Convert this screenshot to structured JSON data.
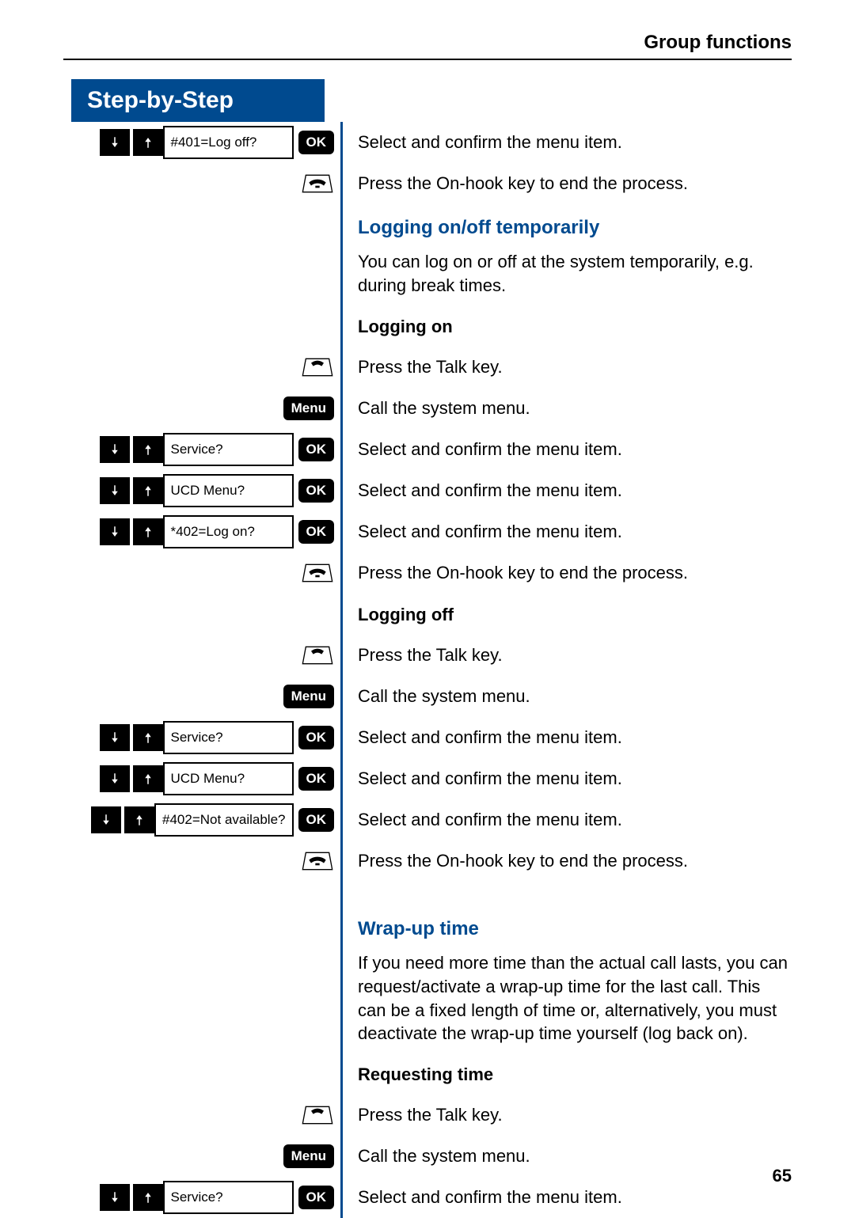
{
  "page": {
    "header": "Group functions",
    "number": "65",
    "sbs_title": "Step-by-Step"
  },
  "labels": {
    "ok": "OK",
    "menu": "Menu"
  },
  "icons": {
    "down": "arrow-down-icon",
    "up": "arrow-up-icon",
    "talk": "talk-key-icon",
    "onhook": "onhook-key-icon"
  },
  "rows": [
    {
      "type": "nav",
      "screen": "#401=Log off?",
      "desc": "Select and confirm the menu item."
    },
    {
      "type": "onhook",
      "desc": "Press the On-hook key to end the process."
    },
    {
      "type": "heading",
      "desc": "Logging on/off temporarily"
    },
    {
      "type": "para",
      "desc": "You can log on or off at the system temporarily, e.g. during break times."
    },
    {
      "type": "subheading",
      "desc": "Logging on"
    },
    {
      "type": "talk",
      "desc": "Press the Talk key."
    },
    {
      "type": "menu",
      "desc": "Call the system menu."
    },
    {
      "type": "nav",
      "screen": "Service?",
      "desc": "Select and confirm the menu item."
    },
    {
      "type": "nav",
      "screen": "UCD Menu?",
      "desc": "Select and confirm the menu item."
    },
    {
      "type": "nav",
      "screen": "*402=Log on?",
      "desc": "Select and confirm the menu item."
    },
    {
      "type": "onhook",
      "desc": "Press the On-hook key to end the process."
    },
    {
      "type": "subheading",
      "desc": "Logging off"
    },
    {
      "type": "talk",
      "desc": "Press the Talk key."
    },
    {
      "type": "menu",
      "desc": "Call the system menu."
    },
    {
      "type": "nav",
      "screen": "Service?",
      "desc": "Select and confirm the menu item."
    },
    {
      "type": "nav",
      "screen": "UCD Menu?",
      "desc": "Select and confirm the menu item."
    },
    {
      "type": "nav",
      "screen": "#402=Not available?",
      "desc": "Select and confirm the menu item."
    },
    {
      "type": "onhook",
      "desc": "Press the On-hook key to end the process."
    },
    {
      "type": "spacer"
    },
    {
      "type": "heading",
      "desc": "Wrap-up time"
    },
    {
      "type": "para",
      "desc": "If you need more time than the actual call lasts, you can request/activate a wrap-up time for the last call. This can be a fixed length of time or, alternatively, you must deactivate the wrap-up time yourself (log back on)."
    },
    {
      "type": "subheading",
      "desc": "Requesting time"
    },
    {
      "type": "talk",
      "desc": "Press the Talk key."
    },
    {
      "type": "menu",
      "desc": "Call the system menu."
    },
    {
      "type": "nav",
      "screen": "Service?",
      "desc": "Select and confirm the menu item."
    }
  ]
}
